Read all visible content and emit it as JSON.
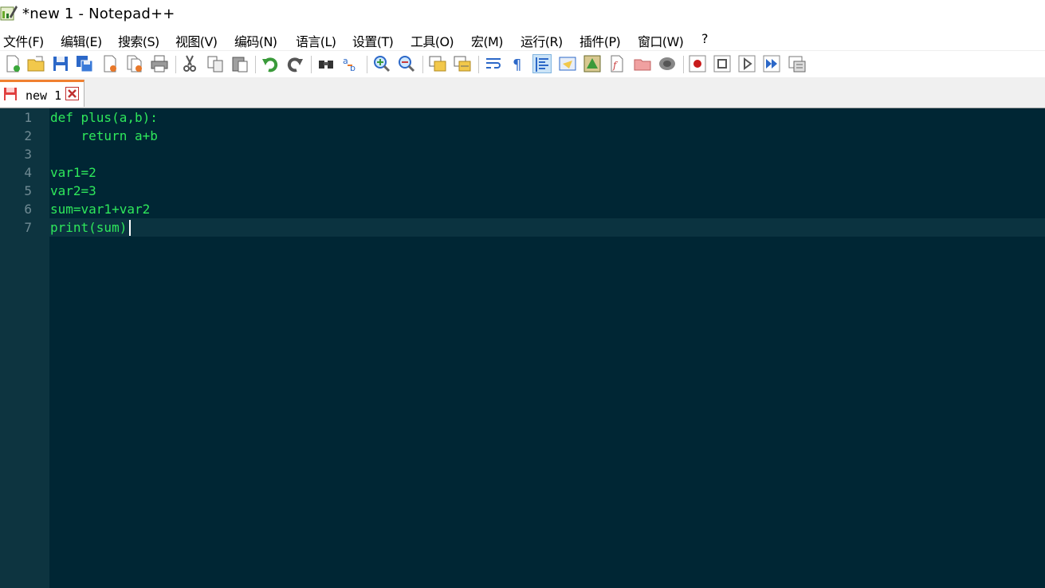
{
  "window": {
    "title": "*new 1 - Notepad++"
  },
  "menu": [
    {
      "label": "文件(F)"
    },
    {
      "label": "编辑(E)"
    },
    {
      "label": "搜索(S)"
    },
    {
      "label": "视图(V)"
    },
    {
      "label": "编码(N)"
    },
    {
      "label": "语言(L)"
    },
    {
      "label": "设置(T)"
    },
    {
      "label": "工具(O)"
    },
    {
      "label": "宏(M)"
    },
    {
      "label": "运行(R)"
    },
    {
      "label": "插件(P)"
    },
    {
      "label": "窗口(W)"
    },
    {
      "label": "?"
    }
  ],
  "toolbar": {
    "icons": [
      "new-file-icon",
      "open-file-icon",
      "save-icon",
      "save-all-icon",
      "close-icon",
      "close-all-icon",
      "print-icon",
      "cut-icon",
      "copy-icon",
      "paste-icon",
      "undo-icon",
      "redo-icon",
      "find-icon",
      "replace-icon",
      "zoom-in-icon",
      "zoom-out-icon",
      "sync-vertical-icon",
      "sync-horizontal-icon",
      "word-wrap-icon",
      "show-all-chars-icon",
      "indent-guide-icon",
      "user-defined-lang-icon",
      "document-map-icon",
      "function-list-icon",
      "folder-workspace-icon",
      "monitoring-icon",
      "record-macro-icon",
      "stop-record-icon",
      "play-macro-icon",
      "run-macro-multiple-icon",
      "save-macro-icon"
    ]
  },
  "tabs": [
    {
      "label": "new 1",
      "modified": true
    }
  ],
  "editor": {
    "background": "#002634",
    "text_color": "#2ee85b",
    "line_numbers": [
      "1",
      "2",
      "3",
      "4",
      "5",
      "6",
      "7"
    ],
    "lines": [
      "def plus(a,b):",
      "    return a+b",
      "",
      "var1=2",
      "var2=3",
      "sum=var1+var2",
      "print(sum)"
    ],
    "current_line": 7
  }
}
